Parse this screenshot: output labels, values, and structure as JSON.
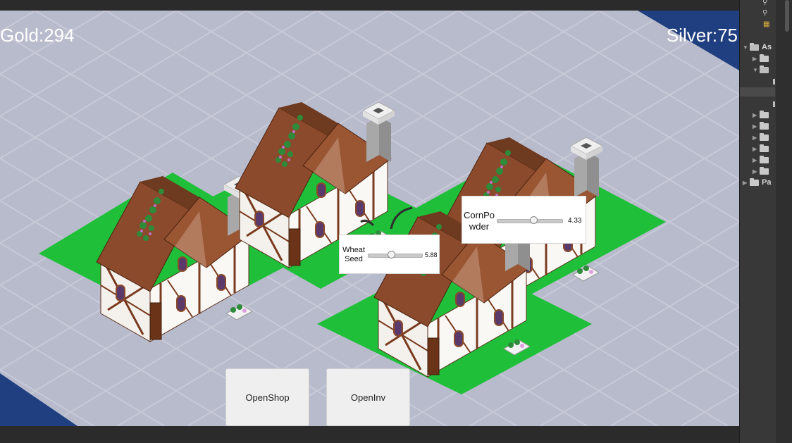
{
  "hud": {
    "gold": "Gold:294",
    "silver": "Silver:75"
  },
  "panels": {
    "wheat": {
      "label": "Wheat\nSeed",
      "value": "5.88",
      "slider_fraction": 0.42
    },
    "corn": {
      "label": "CornPo\nwder",
      "value": "4.33",
      "slider_fraction": 0.55
    }
  },
  "buttons": {
    "open_shop": "OpenShop",
    "open_inv": "OpenInv"
  },
  "project_panel": {
    "folders": [
      {
        "label": "As",
        "expanded": true
      },
      {
        "label": "Pa",
        "expanded": false
      }
    ]
  },
  "colors": {
    "grass": "#1fbf3a",
    "floor": "#b9bccd",
    "roof": "#8b4a2b",
    "wall": "#f4f1ec"
  }
}
